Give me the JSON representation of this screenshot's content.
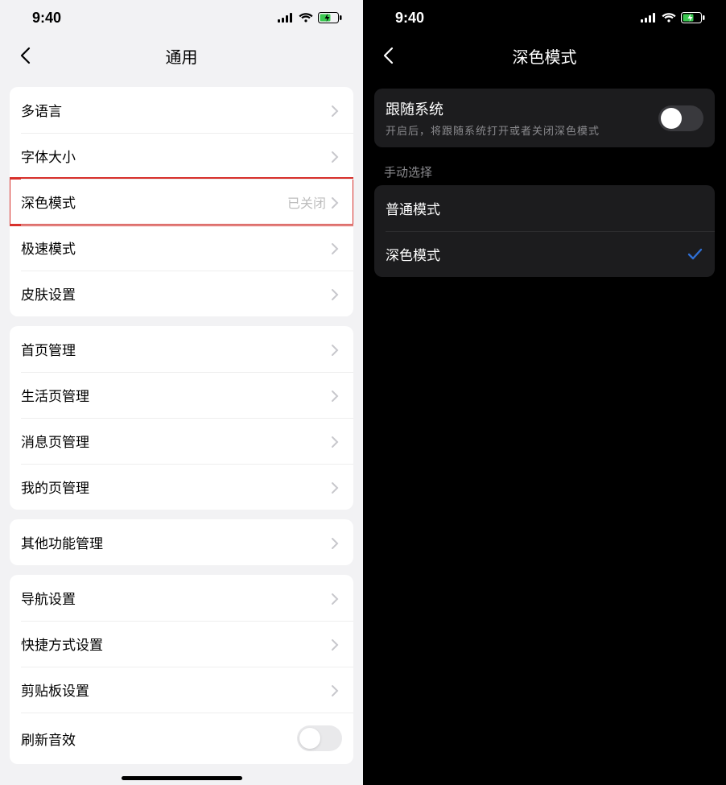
{
  "left": {
    "status": {
      "time": "9:40"
    },
    "nav": {
      "title": "通用"
    },
    "groups": [
      {
        "rows": [
          {
            "label": "多语言",
            "highlight": false
          },
          {
            "label": "字体大小",
            "highlight": false
          },
          {
            "label": "深色模式",
            "value": "已关闭",
            "highlight": true
          },
          {
            "label": "极速模式",
            "highlight": false
          },
          {
            "label": "皮肤设置",
            "highlight": false
          }
        ]
      },
      {
        "rows": [
          {
            "label": "首页管理"
          },
          {
            "label": "生活页管理"
          },
          {
            "label": "消息页管理"
          },
          {
            "label": "我的页管理"
          }
        ]
      },
      {
        "rows": [
          {
            "label": "其他功能管理"
          }
        ]
      },
      {
        "rows": [
          {
            "label": "导航设置"
          },
          {
            "label": "快捷方式设置"
          },
          {
            "label": "剪贴板设置"
          },
          {
            "label": "刷新音效",
            "toggle": true
          }
        ]
      }
    ]
  },
  "right": {
    "status": {
      "time": "9:40"
    },
    "nav": {
      "title": "深色模式"
    },
    "follow": {
      "title": "跟随系统",
      "subtitle": "开启后，将跟随系统打开或者关闭深色模式"
    },
    "section_header": "手动选择",
    "options": [
      {
        "label": "普通模式",
        "selected": false
      },
      {
        "label": "深色模式",
        "selected": true
      }
    ]
  }
}
